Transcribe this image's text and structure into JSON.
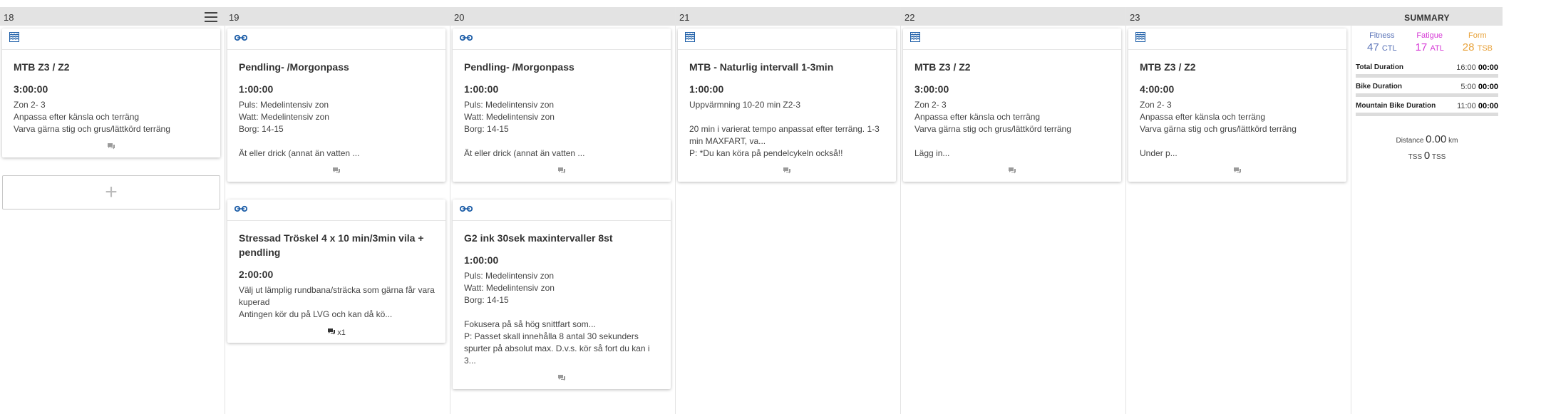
{
  "colors": {
    "fitness": "#5b74b8",
    "fatigue": "#d63ad6",
    "form": "#e8a23a",
    "icon_blue": "#1f5fa8"
  },
  "days": [
    {
      "number": "18",
      "has_menu": true,
      "cards": [
        {
          "icon": "mountain-bike-icon",
          "title": "MTB Z3 / Z2",
          "duration": "3:00:00",
          "description": "Zon 2- 3\nAnpassa efter känsla och terräng\nVarva gärna stig och grus/lättkörd terräng",
          "comment_count": ""
        }
      ],
      "add_label": "+"
    },
    {
      "number": "19",
      "cards": [
        {
          "icon": "road-bike-icon",
          "title": "Pendling- /Morgonpass",
          "duration": "1:00:00",
          "description": "Puls: Medelintensiv zon\nWatt: Medelintensiv zon\nBorg: 14-15\n\nÄt eller drick (annat än vatten ...",
          "comment_count": ""
        },
        {
          "icon": "road-bike-icon",
          "title": "Stressad Tröskel 4 x 10 min/3min vila + pendling",
          "duration": "2:00:00",
          "description": "Välj ut lämplig rundbana/sträcka som gärna får vara kuperad\nAntingen kör du på LVG och kan då kö...",
          "comment_count": "x1"
        }
      ]
    },
    {
      "number": "20",
      "cards": [
        {
          "icon": "road-bike-icon",
          "title": "Pendling- /Morgonpass",
          "duration": "1:00:00",
          "description": "Puls: Medelintensiv zon\nWatt: Medelintensiv zon\nBorg: 14-15\n\nÄt eller drick (annat än vatten ...",
          "comment_count": ""
        },
        {
          "icon": "road-bike-icon",
          "title": "G2 ink 30sek maxintervaller 8st",
          "duration": "1:00:00",
          "description": "Puls: Medelintensiv zon\nWatt: Medelintensiv zon\nBorg: 14-15\n\nFokusera på så hög snittfart som...\nP: Passet skall innehålla 8 antal 30 sekunders spurter på absolut max. D.v.s. kör så fort du kan i 3...",
          "comment_count": ""
        }
      ]
    },
    {
      "number": "21",
      "cards": [
        {
          "icon": "mountain-bike-icon",
          "title": "MTB - Naturlig intervall 1-3min",
          "duration": "1:00:00",
          "description": "Uppvärmning 10-20 min Z2-3\n\n20 min i varierat tempo anpassat efter terräng. 1-3 min MAXFART, va...\nP: *Du kan köra på pendelcykeln också!!",
          "comment_count": ""
        }
      ]
    },
    {
      "number": "22",
      "cards": [
        {
          "icon": "mountain-bike-icon",
          "title": "MTB Z3 / Z2",
          "duration": "3:00:00",
          "description": "Zon 2- 3\nAnpassa efter känsla och terräng\nVarva gärna stig och grus/lättkörd terräng\n\nLägg in...",
          "comment_count": ""
        }
      ]
    },
    {
      "number": "23",
      "cards": [
        {
          "icon": "mountain-bike-icon",
          "title": "MTB Z3 / Z2",
          "duration": "4:00:00",
          "description": "Zon 2- 3\nAnpassa efter känsla och terräng\nVarva gärna stig och grus/lättkörd terräng\n\nUnder p...",
          "comment_count": ""
        }
      ]
    }
  ],
  "summary": {
    "title": "SUMMARY",
    "fitness": {
      "label": "Fitness",
      "value": "47",
      "unit": "CTL"
    },
    "fatigue": {
      "label": "Fatigue",
      "value": "17",
      "unit": "ATL"
    },
    "form": {
      "label": "Form",
      "value": "28",
      "unit": "TSB"
    },
    "durations": [
      {
        "label": "Total Duration",
        "planned": "16:00",
        "completed": "00:00"
      },
      {
        "label": "Bike Duration",
        "planned": "5:00",
        "completed": "00:00"
      },
      {
        "label": "Mountain Bike Duration",
        "planned": "11:00",
        "completed": "00:00"
      }
    ],
    "distance": {
      "label": "Distance",
      "value": "0.00",
      "unit": "km"
    },
    "tss": {
      "label": "TSS",
      "value": "0",
      "unit": "TSS"
    }
  }
}
